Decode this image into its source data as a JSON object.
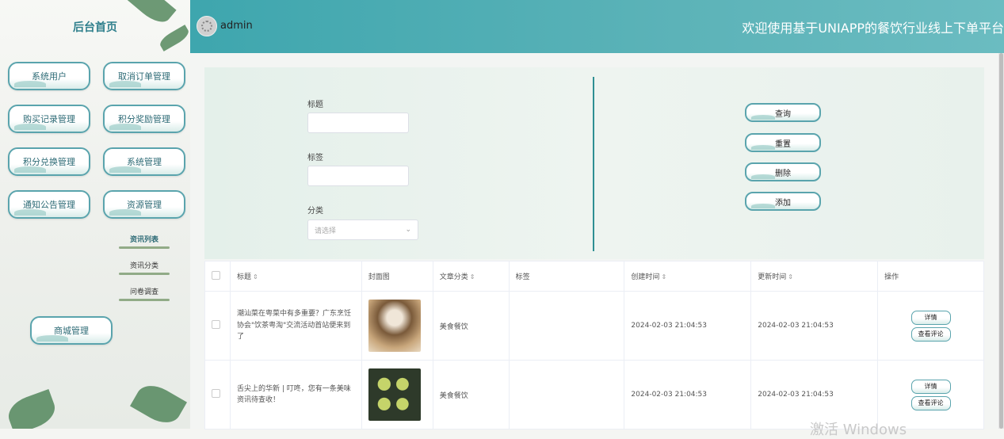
{
  "sidebar": {
    "home": "后台首页",
    "menu": [
      {
        "label": "系统用户"
      },
      {
        "label": "取消订单管理"
      },
      {
        "label": "购买记录管理"
      },
      {
        "label": "积分奖励管理"
      },
      {
        "label": "积分兑换管理"
      },
      {
        "label": "系统管理"
      },
      {
        "label": "通知公告管理"
      },
      {
        "label": "资源管理"
      }
    ],
    "sub_items": [
      {
        "label": "资讯列表"
      },
      {
        "label": "资讯分类"
      },
      {
        "label": "问卷调查"
      }
    ],
    "mall": "商城管理"
  },
  "header": {
    "username": "admin",
    "welcome": "欢迎使用基于UNIAPP的餐饮行业线上下单平台"
  },
  "search": {
    "title_label": "标题",
    "tag_label": "标签",
    "category_label": "分类",
    "category_placeholder": "请选择",
    "buttons": {
      "query": "查询",
      "reset": "重置",
      "delete": "删除",
      "add": "添加"
    }
  },
  "table": {
    "headers": {
      "title": "标题",
      "cover": "封面图",
      "category": "文章分类",
      "tags": "标签",
      "created": "创建时间",
      "updated": "更新时间",
      "actions": "操作"
    },
    "rows": [
      {
        "title": "潮汕菜在粤菜中有多重要？广东烹饪协会\"饮茶粤淘\"交流活动首站便来到了",
        "category": "美食餐饮",
        "tags": "",
        "created": "2024-02-03 21:04:53",
        "updated": "2024-02-03 21:04:53",
        "detail": "详情",
        "comments": "查看评论"
      },
      {
        "title": "舌尖上的华新 | 叮咚，您有一条美味资讯待查收！",
        "category": "美食餐饮",
        "tags": "",
        "created": "2024-02-03 21:04:53",
        "updated": "2024-02-03 21:04:53",
        "detail": "详情",
        "comments": "查看评论"
      }
    ]
  },
  "watermark": "激活 Windows",
  "colors": {
    "header": "#4fb0b6",
    "accent": "#2f8f93",
    "border": "#5aa4ad"
  }
}
